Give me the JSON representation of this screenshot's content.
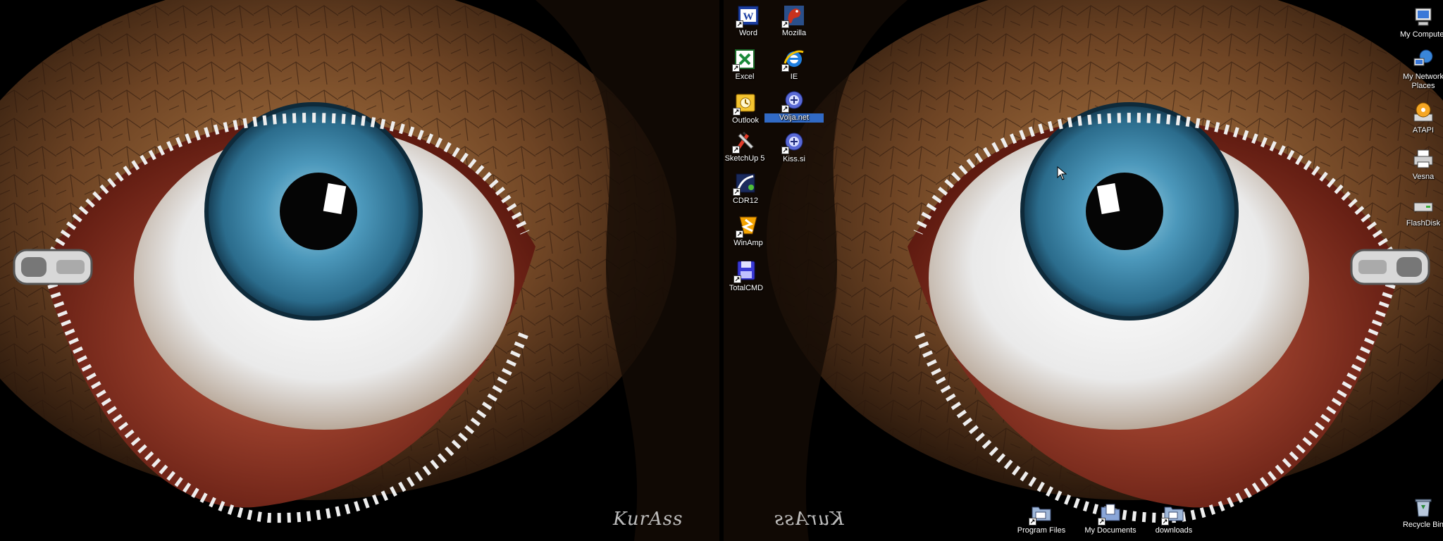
{
  "desktop": {
    "signature": "KurAss",
    "center_column_a": [
      {
        "id": "word",
        "label": "Word",
        "icon": "word-icon"
      },
      {
        "id": "excel",
        "label": "Excel",
        "icon": "excel-icon"
      },
      {
        "id": "outlook",
        "label": "Outlook",
        "icon": "outlook-icon"
      },
      {
        "id": "sketchup",
        "label": "SketchUp 5",
        "icon": "sketchup-icon"
      },
      {
        "id": "cdr12",
        "label": "CDR12",
        "icon": "coreldraw-icon"
      },
      {
        "id": "winamp",
        "label": "WinAmp",
        "icon": "winamp-icon"
      },
      {
        "id": "totalcmd",
        "label": "TotalCMD",
        "icon": "totalcmd-icon"
      }
    ],
    "center_column_b": [
      {
        "id": "mozilla",
        "label": "Mozilla",
        "icon": "mozilla-icon"
      },
      {
        "id": "ie",
        "label": "IE",
        "icon": "internet-explorer-icon"
      },
      {
        "id": "volja",
        "label": "Volja.net",
        "icon": "connection-icon",
        "selected": true
      },
      {
        "id": "kiss",
        "label": "Kiss.si",
        "icon": "connection-icon"
      }
    ],
    "right_column": [
      {
        "id": "mycomputer",
        "label": "My Computer",
        "icon": "my-computer-icon"
      },
      {
        "id": "network",
        "label": "My Network Places",
        "icon": "network-places-icon"
      },
      {
        "id": "atapi",
        "label": "ATAPI",
        "icon": "cd-drive-icon"
      },
      {
        "id": "vesna",
        "label": "Vesna",
        "icon": "printer-icon"
      },
      {
        "id": "flashdisk",
        "label": "FlashDisk",
        "icon": "removable-disk-icon"
      },
      {
        "id": "recyclebin",
        "label": "Recycle Bin",
        "icon": "recycle-bin-icon"
      }
    ],
    "bottom_row": [
      {
        "id": "programfiles",
        "label": "Program Files",
        "icon": "folder-icon"
      },
      {
        "id": "mydocuments",
        "label": "My Documents",
        "icon": "my-documents-icon"
      },
      {
        "id": "downloads",
        "label": "downloads",
        "icon": "folder-icon"
      }
    ]
  },
  "colors": {
    "selection": "#316ac5",
    "iris": "#3f86a8",
    "leaf": "#8a5a2e"
  }
}
